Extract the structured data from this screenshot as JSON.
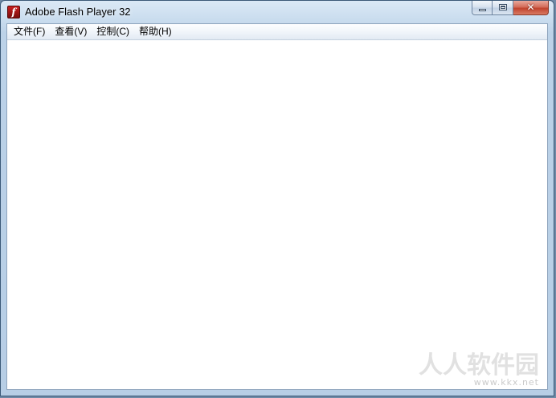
{
  "window": {
    "title": "Adobe Flash Player 32",
    "app_icon_glyph": "f",
    "close_glyph": "✕"
  },
  "menu": {
    "items": [
      {
        "label": "文件(F)"
      },
      {
        "label": "查看(V)"
      },
      {
        "label": "控制(C)"
      },
      {
        "label": "帮助(H)"
      }
    ]
  },
  "watermark": {
    "text": "人人软件园",
    "url": "www.kkx.net"
  },
  "colors": {
    "frame": "#bcd2e8",
    "close_button": "#c0432d",
    "flash_icon": "#c81f1f",
    "content_bg": "#ffffff"
  },
  "icons": {
    "app": "flash-player-icon",
    "minimize": "minimize-icon",
    "maximize": "maximize-icon",
    "close": "close-icon"
  }
}
